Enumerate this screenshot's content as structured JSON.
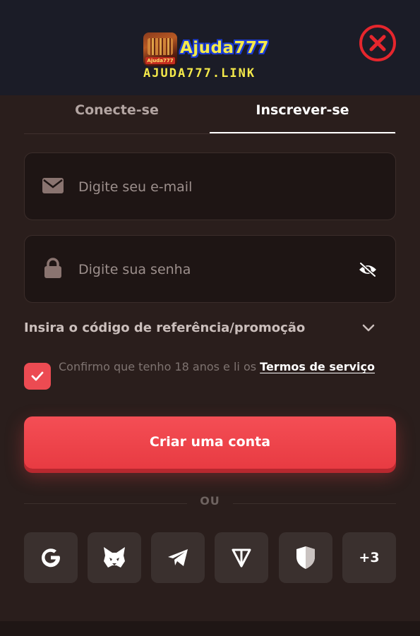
{
  "brand": {
    "name": "Ajuda777",
    "link": "AJUDA777.LINK",
    "logo_icon": "ajuda777-app-icon",
    "logo_tag": "Ajuda777"
  },
  "close_icon": "close-circle-icon",
  "tabs": [
    {
      "label": "Conecte-se",
      "active": false
    },
    {
      "label": "Inscrever-se",
      "active": true
    }
  ],
  "form": {
    "email": {
      "placeholder": "Digite seu e-mail",
      "value": "",
      "icon": "mail-icon"
    },
    "password": {
      "placeholder": "Digite sua senha",
      "value": "",
      "icon": "lock-icon",
      "toggle_icon": "eye-off-icon"
    },
    "promo_label": "Insira o código de referência/promoção",
    "promo_icon": "chevron-down-icon",
    "terms_checked": true,
    "terms_prefix": "Confirmo que tenho 18 anos e li os ",
    "terms_link": "Termos de serviço",
    "submit_label": "Criar uma conta"
  },
  "divider_text": "OU",
  "social": [
    {
      "icon": "google-icon"
    },
    {
      "icon": "metamask-icon"
    },
    {
      "icon": "telegram-icon"
    },
    {
      "icon": "ton-icon"
    },
    {
      "icon": "shield-icon"
    },
    {
      "label": "+3"
    }
  ],
  "colors": {
    "accent": "#ec4b52",
    "brand_yellow": "#f4e94a",
    "close_red": "#e5262d",
    "background": "#2a1e1c",
    "header": "#1b1c27"
  }
}
